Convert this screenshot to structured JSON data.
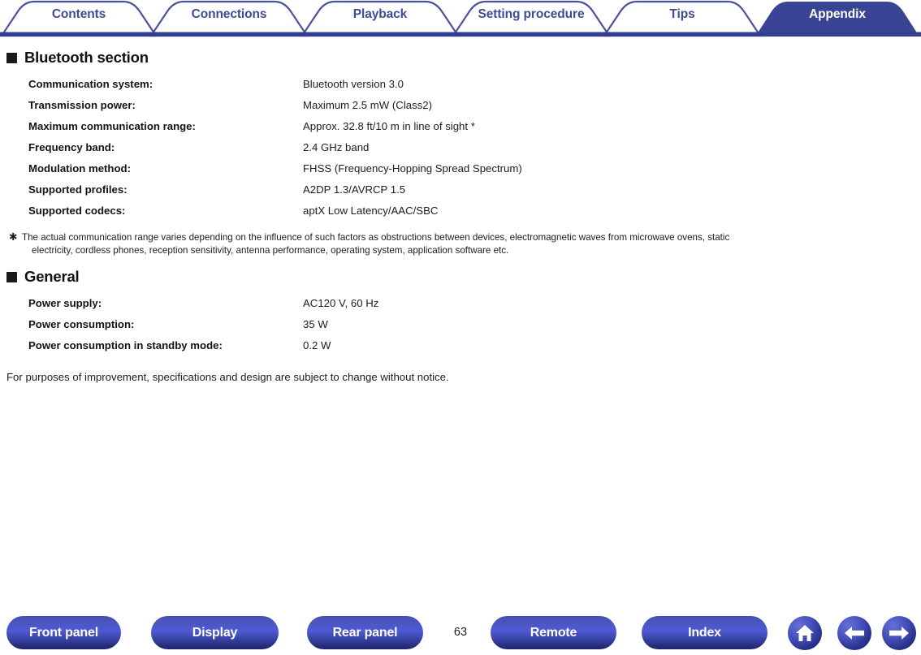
{
  "tabs": [
    {
      "label": "Contents",
      "active": false
    },
    {
      "label": "Connections",
      "active": false
    },
    {
      "label": "Playback",
      "active": false
    },
    {
      "label": "Setting procedure",
      "active": false
    },
    {
      "label": "Tips",
      "active": false
    },
    {
      "label": "Appendix",
      "active": true
    }
  ],
  "sections": [
    {
      "heading": "Bluetooth section",
      "rows": [
        {
          "label": "Communication system:",
          "value": "Bluetooth version 3.0"
        },
        {
          "label": "Transmission power:",
          "value": "Maximum 2.5 mW (Class2)"
        },
        {
          "label": "Maximum communication range:",
          "value": "Approx. 32.8 ft/10 m in line of sight *"
        },
        {
          "label": "Frequency band:",
          "value": "2.4 GHz band"
        },
        {
          "label": "Modulation method:",
          "value": "FHSS (Frequency-Hopping Spread Spectrum)"
        },
        {
          "label": "Supported profiles:",
          "value": "A2DP 1.3/AVRCP 1.5"
        },
        {
          "label": "Supported codecs:",
          "value": "aptX Low Latency/AAC/SBC"
        }
      ]
    },
    {
      "heading": "General",
      "rows": [
        {
          "label": "Power supply:",
          "value": "AC120 V, 60 Hz"
        },
        {
          "label": "Power consumption:",
          "value": "35 W"
        },
        {
          "label": "Power consumption in standby mode:",
          "value": "0.2 W"
        }
      ]
    }
  ],
  "footnote": {
    "marker": "✱",
    "line1": "The actual communication range varies depending on the influence of such factors as obstructions between devices, electromagnetic waves from microwave ovens, static",
    "line2": "electricity, cordless phones, reception sensitivity, antenna performance, operating system, application software etc."
  },
  "closing_text": "For purposes of improvement, specifications and design are subject to change without notice.",
  "footer": {
    "buttons": [
      {
        "label": "Front panel"
      },
      {
        "label": "Display"
      },
      {
        "label": "Rear panel"
      },
      {
        "label": "Remote"
      },
      {
        "label": "Index"
      }
    ],
    "icons": [
      {
        "name": "home-icon"
      },
      {
        "name": "back-arrow-icon"
      },
      {
        "name": "forward-arrow-icon"
      }
    ],
    "page_number": "63"
  },
  "colors": {
    "tab_blue": "#3a4494",
    "tab_text": "#414a97",
    "rule_blue": "#343e91",
    "button_blue": "#4a56c4",
    "text_black": "#1a1a1a"
  }
}
